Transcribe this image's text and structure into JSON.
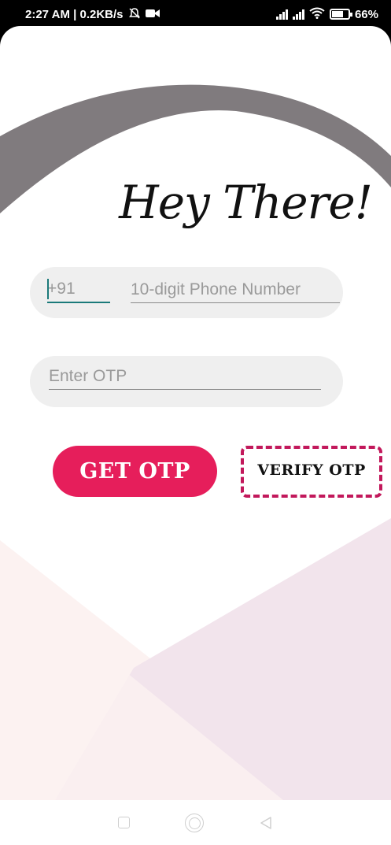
{
  "status_bar": {
    "time_speed": "2:27 AM | 0.2KB/s",
    "battery_percent": "66%"
  },
  "greeting": "Hey There!",
  "phone": {
    "country_code_placeholder": "+91",
    "number_placeholder": "10-digit Phone Number"
  },
  "otp": {
    "placeholder": "Enter OTP"
  },
  "buttons": {
    "get_otp": "GET OTP",
    "verify_otp": "VERIFY OTP"
  },
  "colors": {
    "accent": "#e61e5b",
    "dashed_border": "#c2185b",
    "input_cursor": "#1b7a7a",
    "arc_gray": "#807b7e",
    "bottom_light_pink": "#fcf2f1",
    "bottom_mauve": "#f2e4ec"
  },
  "icons": {
    "status": [
      "muted-bell-icon",
      "video-camera-icon",
      "signal-icon",
      "signal-icon",
      "wifi-icon",
      "battery-icon"
    ],
    "nav": [
      "recent-apps-icon",
      "home-icon",
      "back-icon"
    ]
  }
}
